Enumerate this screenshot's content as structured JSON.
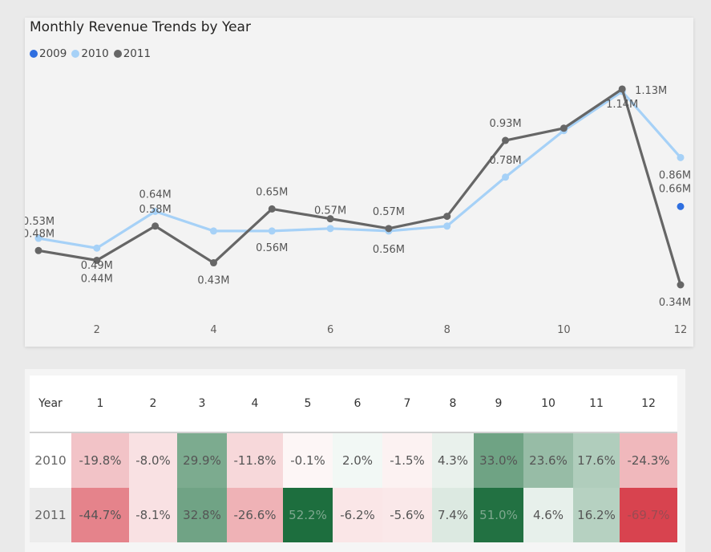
{
  "chart_data": {
    "type": "line",
    "title": "Monthly Revenue Trends by Year",
    "x_ticks": [
      2,
      4,
      6,
      8,
      10,
      12
    ],
    "xlim": [
      1,
      12
    ],
    "ylim": [
      0.3,
      1.2
    ],
    "legend_position": "top-left",
    "series": [
      {
        "name": "2009",
        "color": "#2f6fe0",
        "x": [
          12
        ],
        "y": [
          0.66
        ]
      },
      {
        "name": "2010",
        "color": "#a6d1f7",
        "x": [
          1,
          2,
          3,
          4,
          5,
          6,
          7,
          8,
          9,
          10,
          11,
          12
        ],
        "y": [
          0.53,
          0.49,
          0.64,
          0.56,
          0.56,
          0.57,
          0.56,
          0.58,
          0.78,
          0.97,
          1.13,
          0.86
        ]
      },
      {
        "name": "2011",
        "color": "#666666",
        "x": [
          1,
          2,
          3,
          4,
          5,
          6,
          7,
          8,
          9,
          10,
          11,
          12
        ],
        "y": [
          0.48,
          0.44,
          0.58,
          0.43,
          0.65,
          0.61,
          0.57,
          0.62,
          0.93,
          0.98,
          1.14,
          0.34
        ]
      }
    ],
    "data_labels": [
      {
        "series": "2010",
        "x": 1,
        "text": "0.53M"
      },
      {
        "series": "2011",
        "x": 1,
        "text": "0.48M"
      },
      {
        "series": "2010",
        "x": 2,
        "text": "0.49M"
      },
      {
        "series": "2011",
        "x": 2,
        "text": "0.44M"
      },
      {
        "series": "2010",
        "x": 3,
        "text": "0.64M"
      },
      {
        "series": "2011",
        "x": 3,
        "text": "0.58M"
      },
      {
        "series": "2011",
        "x": 4,
        "text": "0.43M"
      },
      {
        "series": "2011",
        "x": 5,
        "text": "0.65M"
      },
      {
        "series": "2010",
        "x": 5,
        "text": "0.56M"
      },
      {
        "series": "2011",
        "x": 6,
        "text": "0.57M"
      },
      {
        "series": "2011",
        "x": 7,
        "text": "0.57M"
      },
      {
        "series": "2010",
        "x": 7,
        "text": "0.56M"
      },
      {
        "series": "2011",
        "x": 9,
        "text": "0.93M"
      },
      {
        "series": "2010",
        "x": 9,
        "text": "0.78M"
      },
      {
        "series": "2010",
        "x": 11,
        "text": "1.13M"
      },
      {
        "series": "2011",
        "x": 11,
        "text": "1.14M"
      },
      {
        "series": "2010",
        "x": 12,
        "text": "0.86M"
      },
      {
        "series": "2009",
        "x": 12,
        "text": "0.66M"
      },
      {
        "series": "2011",
        "x": 12,
        "text": "0.34M"
      }
    ]
  },
  "table": {
    "header_year": "Year",
    "months": [
      "1",
      "2",
      "3",
      "4",
      "5",
      "6",
      "7",
      "8",
      "9",
      "10",
      "11",
      "12"
    ],
    "rows": [
      {
        "year": "2010",
        "cells": [
          "-19.8%",
          "-8.0%",
          "29.9%",
          "-11.8%",
          "-0.1%",
          "2.0%",
          "-1.5%",
          "4.3%",
          "33.0%",
          "23.6%",
          "17.6%",
          "-24.3%"
        ],
        "values": [
          -19.8,
          -8.0,
          29.9,
          -11.8,
          -0.1,
          2.0,
          -1.5,
          4.3,
          33.0,
          23.6,
          17.6,
          -24.3
        ]
      },
      {
        "year": "2011",
        "cells": [
          "-44.7%",
          "-8.1%",
          "32.8%",
          "-26.6%",
          "52.2%",
          "-6.2%",
          "-5.6%",
          "7.4%",
          "51.0%",
          "4.6%",
          "16.2%",
          "-69.7%"
        ],
        "values": [
          -44.7,
          -8.1,
          32.8,
          -26.6,
          52.2,
          -6.2,
          -5.6,
          7.4,
          51.0,
          4.6,
          16.2,
          -69.7
        ]
      }
    ]
  }
}
